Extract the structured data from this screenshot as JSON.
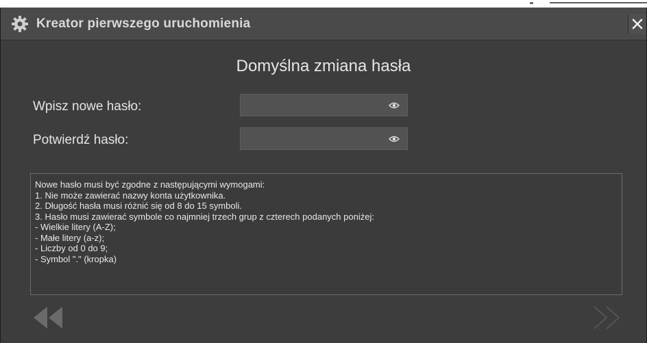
{
  "window": {
    "title": "Kreator pierwszego uruchomienia",
    "close_icon": "close-icon",
    "settings_icon": "gear-icon"
  },
  "page": {
    "heading": "Domyślna zmiana hasła"
  },
  "form": {
    "new_password": {
      "label": "Wpisz nowe hasło:",
      "value": "",
      "toggle_icon": "eye-icon"
    },
    "confirm_password": {
      "label": "Potwierdź hasło:",
      "value": "",
      "toggle_icon": "eye-icon"
    }
  },
  "requirements": {
    "lines": [
      "Nowe hasło musi być zgodne z następującymi wymogami:",
      "1. Nie może zawierać nazwy konta użytkownika.",
      "2. Długość hasła musi różnić się od 8 do 15 symboli.",
      "3. Hasło musi zawierać symbole co najmniej trzech grup z czterech podanych poniżej:",
      "- Wielkie litery (A-Z);",
      "- Małe litery (a-z);",
      "- Liczby od 0 do 9;",
      "- Symbol \".\" (kropka)"
    ]
  },
  "navigation": {
    "back_icon": "double-chevron-left-icon",
    "forward_icon": "double-chevron-right-icon"
  },
  "colors": {
    "dialog_background": "#3d3d3d",
    "titlebar_background": "#4a4a4a",
    "field_background": "#525252",
    "text": "#e4e4e4",
    "nav_back_fill": "#6a6a6a",
    "nav_forward_outline": "#5a5a5a"
  }
}
